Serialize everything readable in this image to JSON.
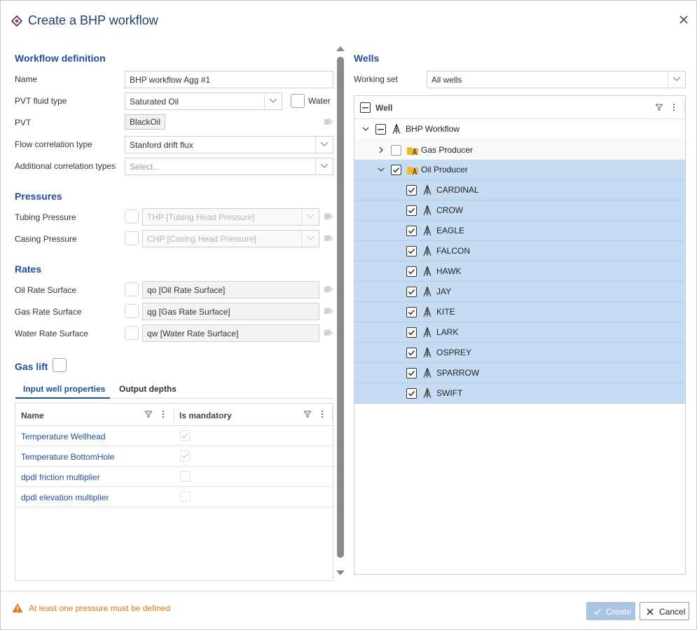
{
  "dialog": {
    "title": "Create a BHP workflow",
    "close_label": "×"
  },
  "workflow_definition": {
    "section_title": "Workflow definition",
    "name_label": "Name",
    "name_value": "BHP workflow Agg #1",
    "pvt_fluid_type_label": "PVT fluid type",
    "pvt_fluid_type_value": "Saturated Oil",
    "water_label": "Water",
    "water_checked": false,
    "pvt_label": "PVT",
    "pvt_value": "BlackOil",
    "flow_correlation_label": "Flow correlation type",
    "flow_correlation_value": "Stanford drift flux",
    "additional_correlation_label": "Additional correlation types",
    "additional_correlation_placeholder": "Select..."
  },
  "pressures": {
    "section_title": "Pressures",
    "tubing_label": "Tubing Pressure",
    "tubing_value": "THP [Tubing Head Pressure]",
    "casing_label": "Casing Pressure",
    "casing_value": "CHP [Casing Head Pressure]"
  },
  "rates": {
    "section_title": "Rates",
    "oil_label": "Oil Rate Surface",
    "oil_value": "qo [Oil Rate Surface]",
    "gas_label": "Gas Rate Surface",
    "gas_value": "qg [Gas Rate Surface]",
    "water_label": "Water Rate Surface",
    "water_value": "qw [Water Rate Surface]"
  },
  "gas_lift": {
    "label": "Gas lift",
    "checked": false
  },
  "tabs": [
    {
      "label": "Input well properties",
      "active": true
    },
    {
      "label": "Output depths",
      "active": false
    }
  ],
  "properties_grid": {
    "columns": [
      "Name",
      "Is mandatory"
    ],
    "rows": [
      {
        "name": "Temperature Wellhead",
        "mandatory": true
      },
      {
        "name": "Temperature BottomHole",
        "mandatory": true
      },
      {
        "name": "dpdl friction multiplier",
        "mandatory": false
      },
      {
        "name": "dpdl elevation multiplier",
        "mandatory": false
      }
    ]
  },
  "wells": {
    "section_title": "Wells",
    "working_set_label": "Working set",
    "working_set_value": "All wells",
    "column_header": "Well",
    "root": "BHP Workflow",
    "groups": [
      {
        "name": "Gas Producer",
        "expanded": false,
        "checked": false
      },
      {
        "name": "Oil Producer",
        "expanded": true,
        "checked": true
      }
    ],
    "oil_wells": [
      "CARDINAL",
      "CROW",
      "EAGLE",
      "FALCON",
      "HAWK",
      "JAY",
      "KITE",
      "LARK",
      "OSPREY",
      "SPARROW",
      "SWIFT"
    ]
  },
  "footer": {
    "warning": "At least one pressure must be defined",
    "create_label": "Create",
    "cancel_label": "Cancel"
  },
  "colors": {
    "accent": "#1f4e9b",
    "selection": "#c5dcf3",
    "warning": "#e07a10",
    "disabled_button": "#a9c4e6"
  }
}
